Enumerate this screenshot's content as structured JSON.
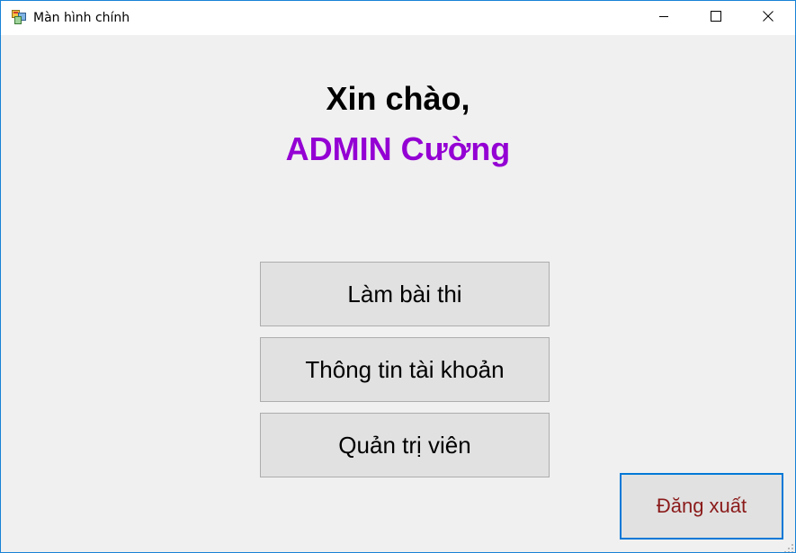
{
  "window": {
    "title": "Màn hình chính",
    "icons": {
      "app": "app-window-icon",
      "minimize": "minimize-icon",
      "maximize": "maximize-icon",
      "close": "close-icon"
    }
  },
  "main": {
    "greeting": "Xin chào,",
    "username": "ADMIN Cường",
    "menu": {
      "exam_label": "Làm bài thi",
      "account_label": "Thông tin tài khoản",
      "admin_label": "Quản trị viên"
    },
    "logout_label": "Đăng xuất"
  },
  "colors": {
    "username": "#9400d3",
    "logout_text": "#8b1a1a",
    "focus_border": "#0078d7"
  }
}
